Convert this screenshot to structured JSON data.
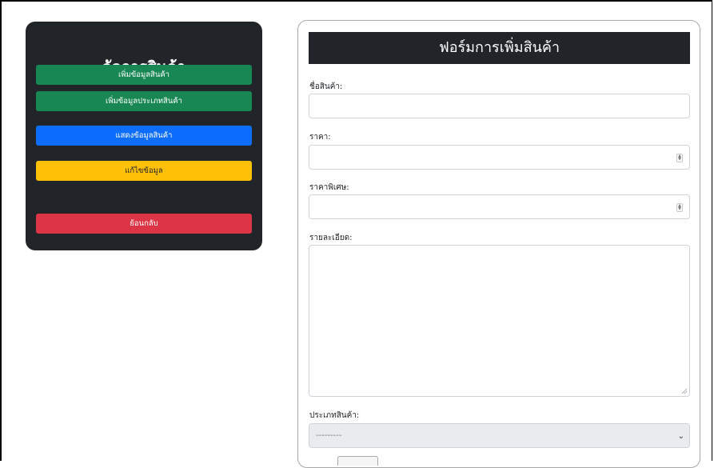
{
  "sidebar": {
    "title": "จัดการสินค้า",
    "buttons": [
      {
        "label": "เพิ่มข้อมูลสินค้า",
        "color": "#198754"
      },
      {
        "label": "เพิ่มข้อมูลประเภทสินค้า",
        "color": "#198754"
      },
      {
        "label": "แสดงข้อมูลสินค้า",
        "color": "#0d6efd"
      },
      {
        "label": "แก้ไขข้อมูล",
        "color": "#ffc107"
      },
      {
        "label": "ย้อนกลับ",
        "color": "#dc3545"
      }
    ]
  },
  "form": {
    "header": "ฟอร์มการเพิ่มสินค้า",
    "fields": {
      "name_label": "ชื่อสินค้า:",
      "price_label": "ราคา:",
      "special_price_label": "ราคาพิเศษ:",
      "detail_label": "รายละเอียด:",
      "category_label": "ประเภทสินค้า:",
      "category_selected": "---------"
    }
  }
}
